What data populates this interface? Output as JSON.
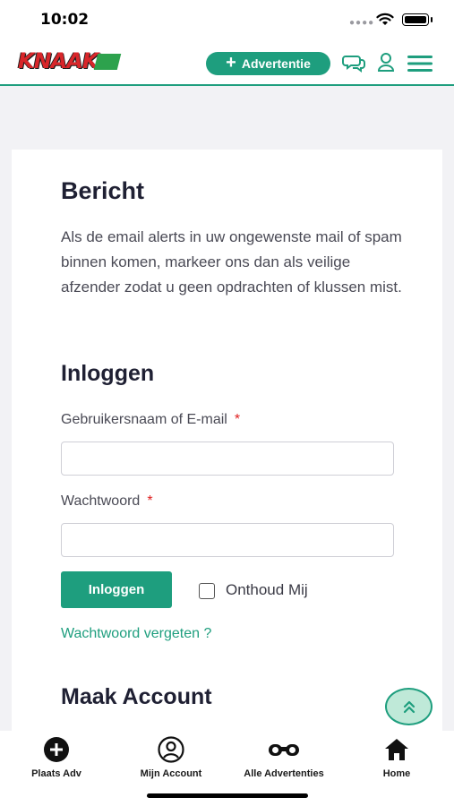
{
  "status_bar": {
    "time": "10:02"
  },
  "header": {
    "logo_text": "KNAAK",
    "ad_button_label": "Advertentie",
    "accent_color": "#1e9e7e"
  },
  "card": {
    "message_title": "Bericht",
    "message_text": "Als de email alerts in uw ongewenste mail of spam binnen komen, markeer ons dan als veilige afzender zodat u geen opdrachten of klussen mist.",
    "login_title": "Inloggen",
    "username_label": "Gebruikersnaam of E-mail",
    "username_value": "",
    "password_label": "Wachtwoord",
    "password_value": "",
    "required_mark": "*",
    "login_button": "Inloggen",
    "remember_label": "Onthoud Mij",
    "forgot_link": "Wachtwoord vergeten ?",
    "register_title": "Maak Account"
  },
  "bottom_nav": {
    "items": [
      {
        "label": "Plaats Adv",
        "icon": "plus-circle-icon"
      },
      {
        "label": "Mijn Account",
        "icon": "user-circle-icon"
      },
      {
        "label": "Alle Advertenties",
        "icon": "binoculars-icon"
      },
      {
        "label": "Home",
        "icon": "home-icon"
      }
    ]
  }
}
